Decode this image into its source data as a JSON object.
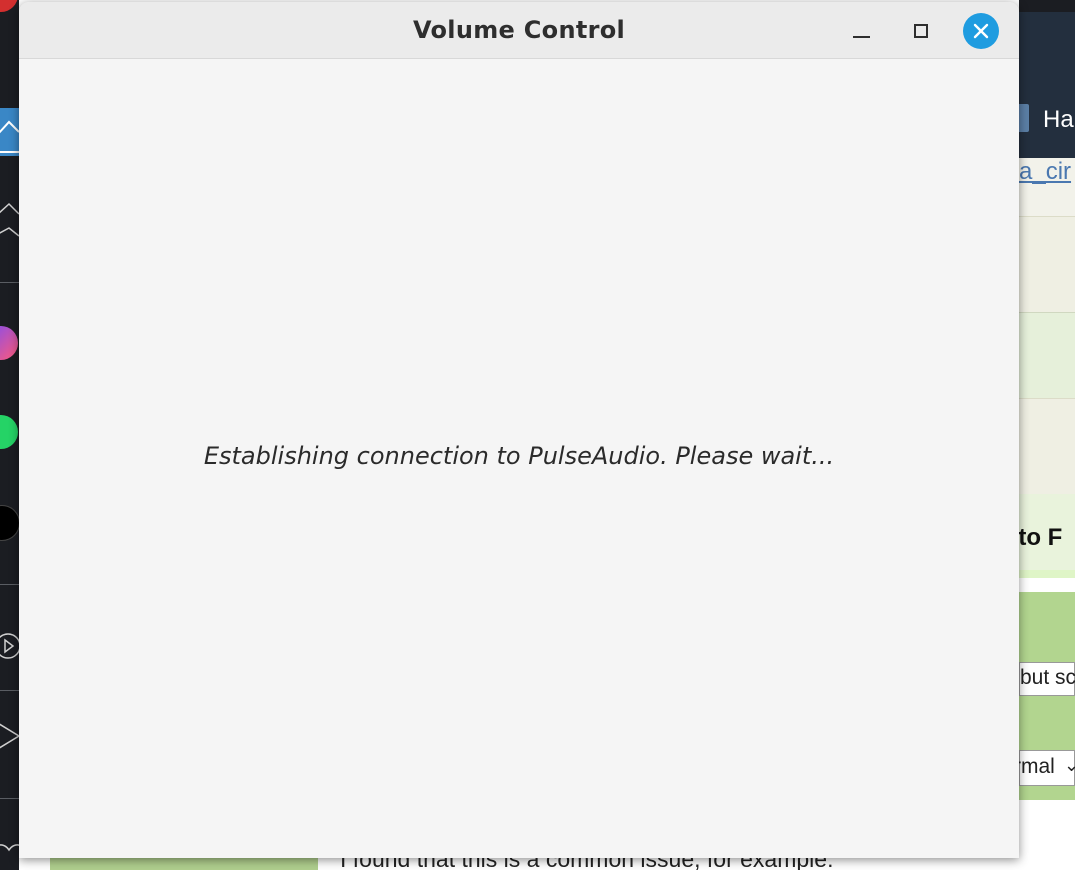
{
  "window": {
    "title": "Volume Control",
    "status_message": "Establishing connection to PulseAudio. Please wait...",
    "controls": {
      "minimize_icon": "minimize-icon",
      "maximize_icon": "maximize-icon",
      "close_icon": "close-icon"
    },
    "colors": {
      "close_button": "#1f9ce0",
      "titlebar": "#ebebeb",
      "body": "#f5f5f5"
    }
  },
  "dock": {
    "items": [
      "home-icon",
      "app-icon",
      "messenger-icon",
      "whatsapp-icon",
      "tiktok-icon",
      "player-icon",
      "send-icon",
      "heart-icon"
    ]
  },
  "background_page": {
    "header_text": "Ha",
    "link_text": "a_cir",
    "heading_text": "n to F",
    "field_text": "but sc",
    "select_text": "rmal",
    "body_text": "I found that this is a common issue, for example:"
  }
}
